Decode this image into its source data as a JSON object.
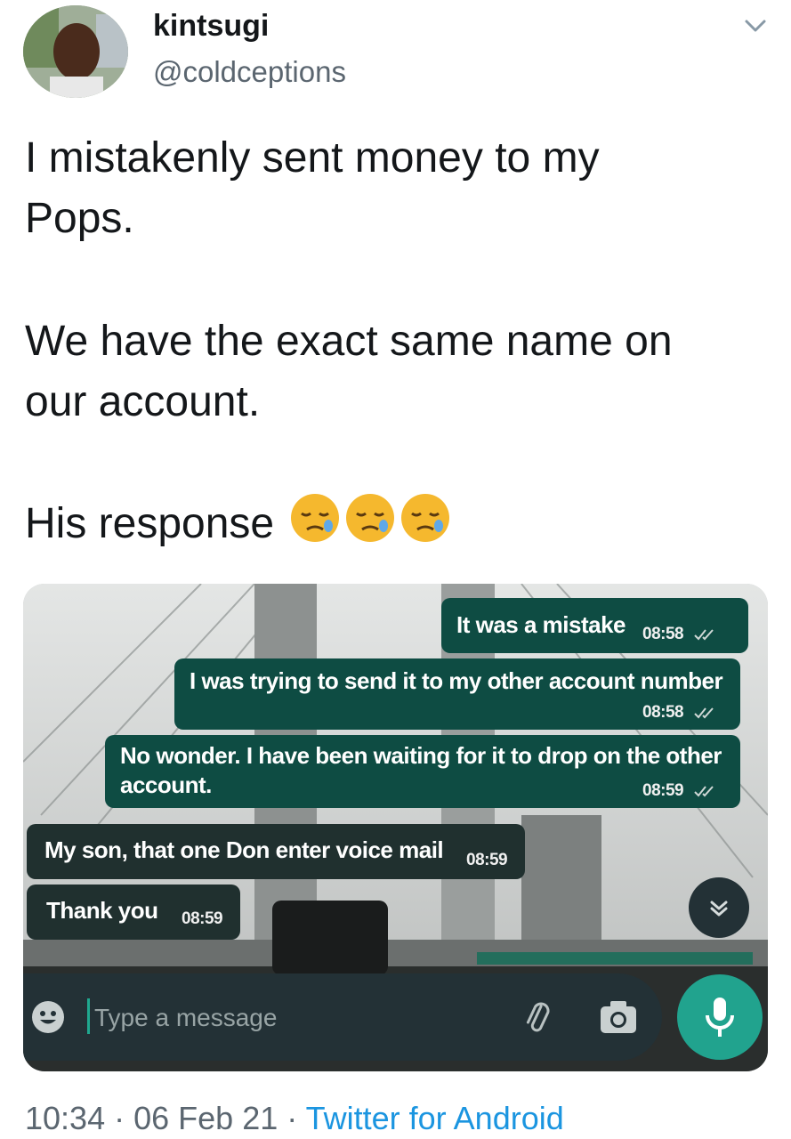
{
  "tweet": {
    "display_name": "kintsugi",
    "handle": "@coldceptions",
    "text_line1": "I mistakenly sent money to my",
    "text_line2": "Pops.",
    "text_line3": "We have the exact same name on",
    "text_line4": "our account.",
    "text_line5": "His response",
    "emoji": [
      "sleepy-face",
      "sleepy-face",
      "sleepy-face"
    ],
    "time": "10:34",
    "sep1": "·",
    "date": "06 Feb 21",
    "sep2": "·",
    "source": "Twitter for Android"
  },
  "chat": {
    "messages": [
      {
        "dir": "out",
        "text": "It was a mistake",
        "time": "08:58"
      },
      {
        "dir": "out",
        "text": "I was trying to send it to my other account number",
        "time": "08:58"
      },
      {
        "dir": "out",
        "text_l1": "No wonder. I have been waiting for it to drop on the other",
        "text_l2": "account.",
        "time": "08:59"
      },
      {
        "dir": "in",
        "text": "My son, that one Don enter voice mail",
        "time": "08:59"
      },
      {
        "dir": "in",
        "text": "Thank you",
        "time": "08:59"
      }
    ],
    "input_placeholder": "Type a message"
  },
  "colors": {
    "outgoing_bubble": "#0e4c43",
    "incoming_bubble": "#20302f",
    "mic_button": "#21a38e",
    "link": "#1b95e0"
  }
}
